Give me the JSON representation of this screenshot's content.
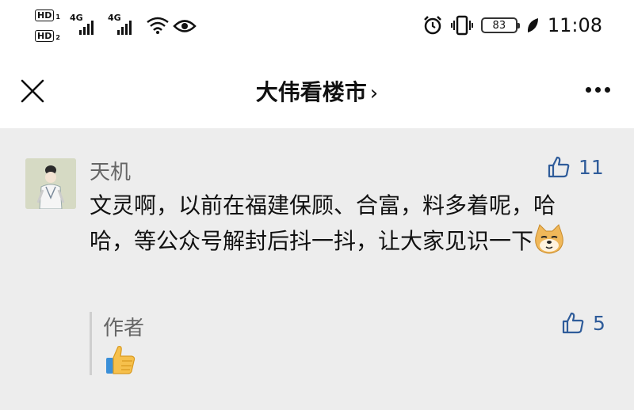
{
  "status_bar": {
    "hd1": "HD",
    "hd1_sub": "1",
    "hd2": "HD",
    "hd2_sub": "2",
    "net1": "4G",
    "net2": "4G",
    "battery": "83",
    "time": "11:08"
  },
  "nav": {
    "title": "大伟看楼市",
    "chevron": "›"
  },
  "comment": {
    "nickname": "天机",
    "likes": "11",
    "text": "文灵啊，以前在福建保顾、合富，料多着呢，哈哈，等公众号解封后抖一抖，让大家见识一下",
    "reply": {
      "author_label": "作者",
      "likes": "5"
    }
  },
  "colors": {
    "background": "#ededed",
    "header": "#ffffff",
    "like_blue": "#2f5c9a",
    "nickname_gray": "#666666"
  }
}
